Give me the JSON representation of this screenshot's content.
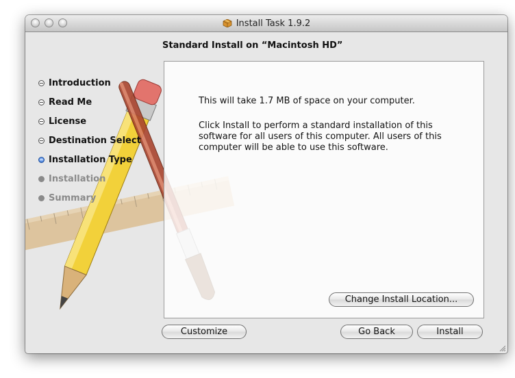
{
  "window": {
    "title": "Install Task 1.9.2",
    "title_icon": "package-icon"
  },
  "heading": "Standard Install on “Macintosh HD”",
  "steps": [
    {
      "label": "Introduction",
      "state": "done"
    },
    {
      "label": "Read Me",
      "state": "done"
    },
    {
      "label": "License",
      "state": "done"
    },
    {
      "label": "Destination Select",
      "state": "done"
    },
    {
      "label": "Installation Type",
      "state": "current"
    },
    {
      "label": "Installation",
      "state": "future"
    },
    {
      "label": "Summary",
      "state": "future"
    }
  ],
  "content": {
    "space_message": "This will take 1.7 MB of space on your computer.",
    "install_message": "Click Install to perform a standard installation of this software for all users of this computer. All users of this computer will be able to use this software."
  },
  "buttons": {
    "change_location": "Change Install Location...",
    "customize": "Customize",
    "go_back": "Go Back",
    "install": "Install"
  },
  "colors": {
    "current_step": "#2a66c9",
    "future_step": "#8a8a8a"
  }
}
